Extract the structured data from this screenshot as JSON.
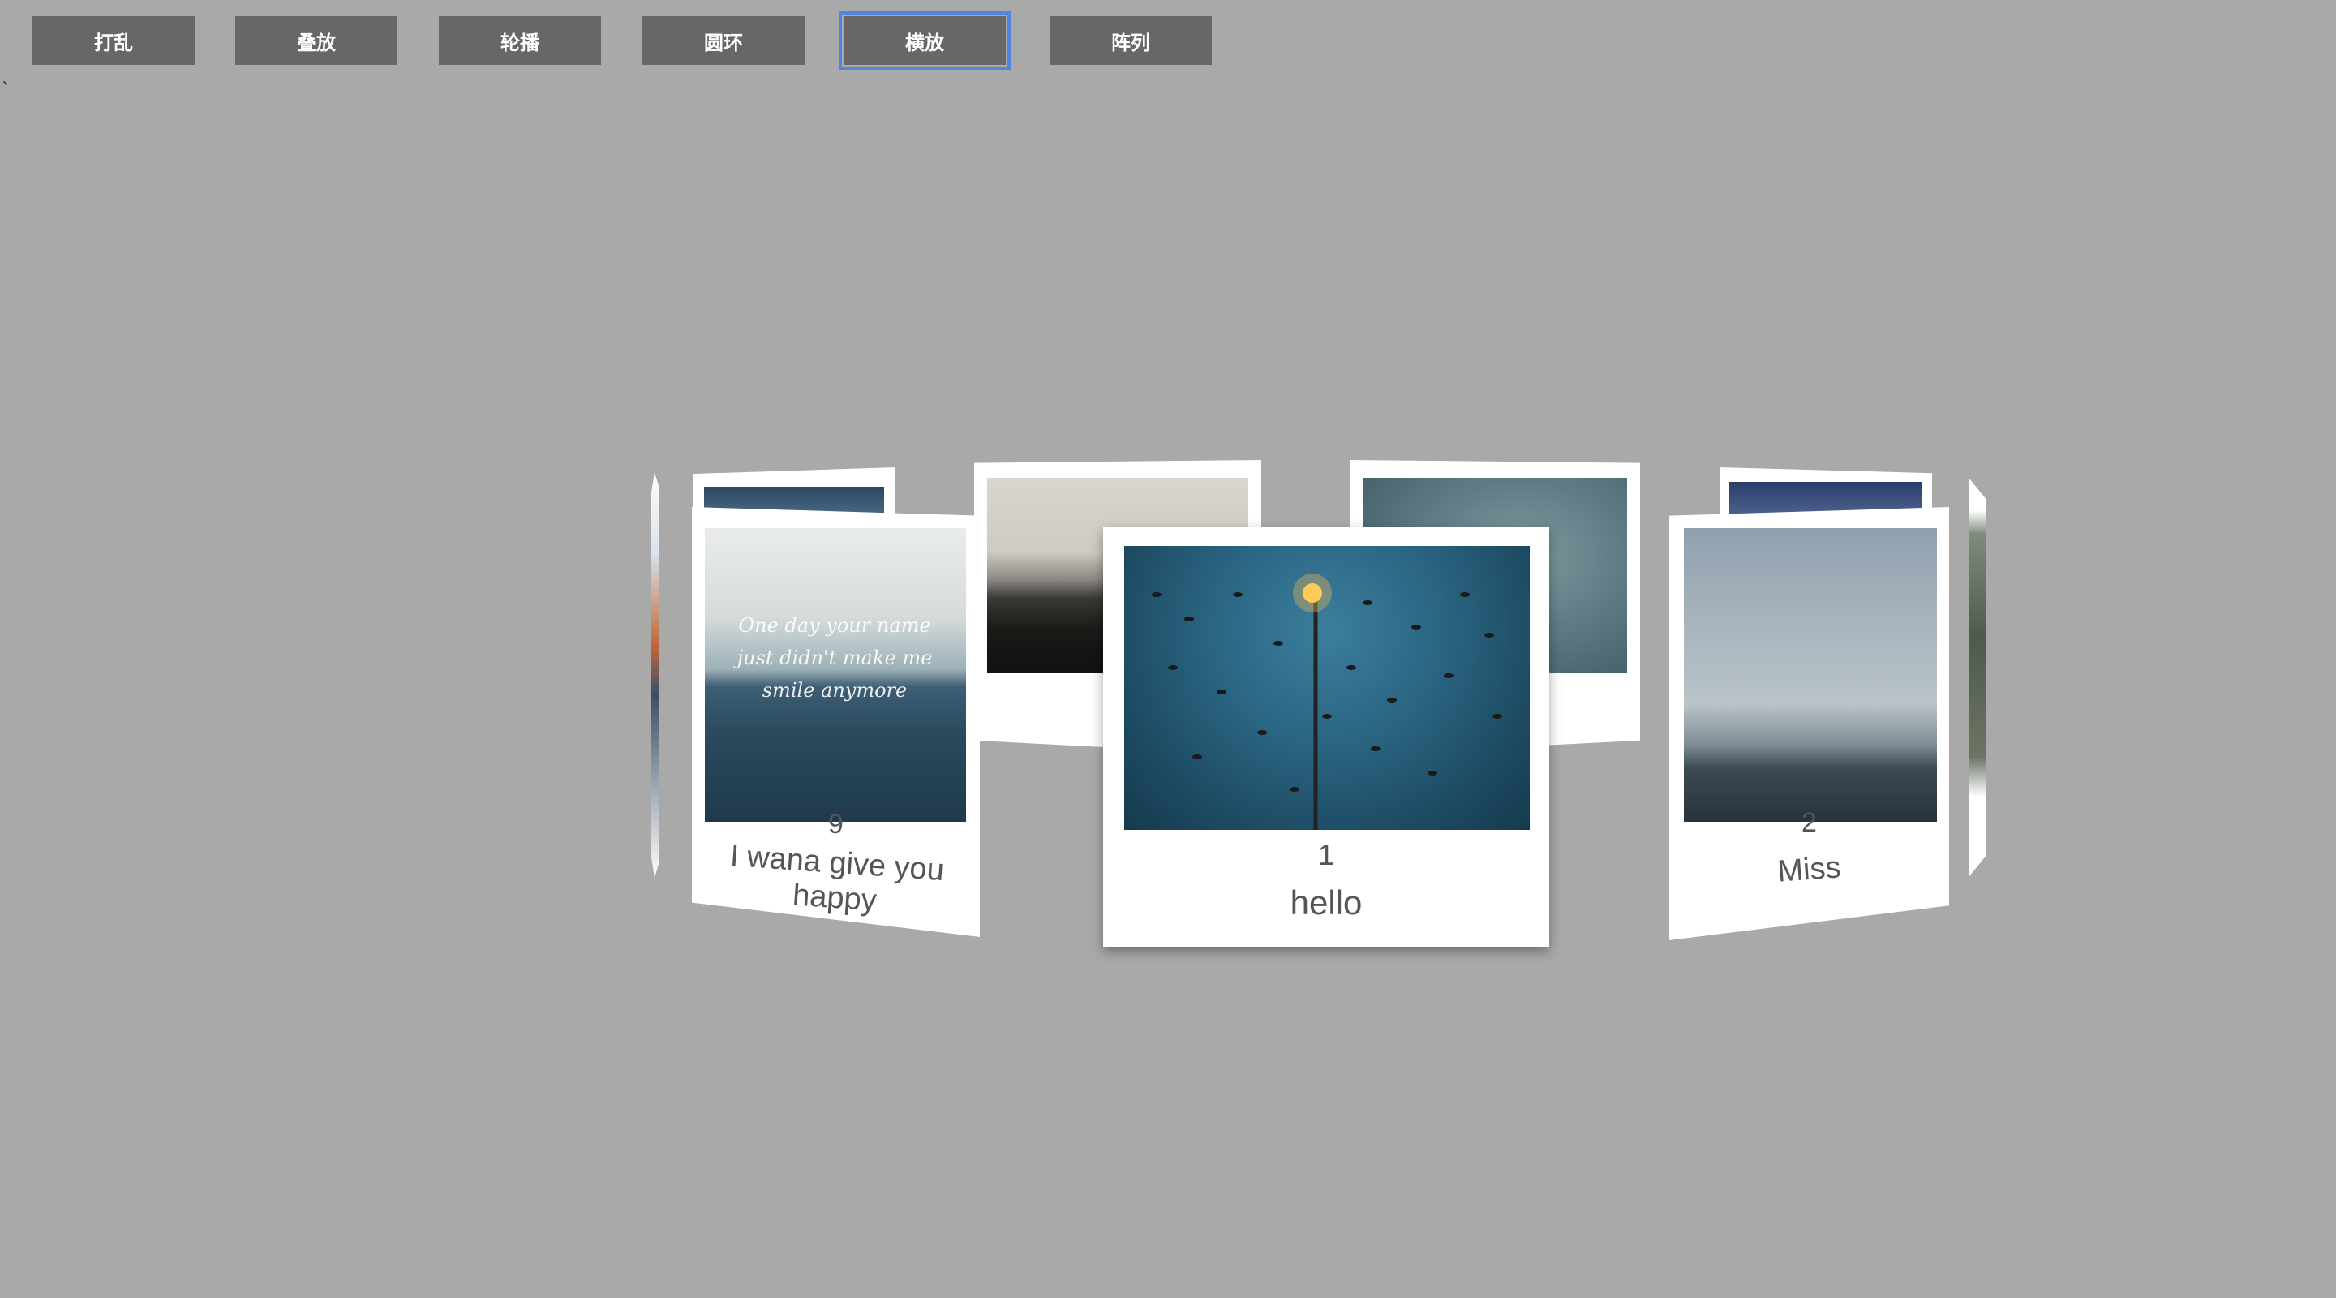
{
  "toolbar": {
    "buttons": [
      {
        "label": "打乱"
      },
      {
        "label": "叠放"
      },
      {
        "label": "轮播"
      },
      {
        "label": "圆环"
      },
      {
        "label": "横放"
      },
      {
        "label": "阵列"
      }
    ],
    "active_index": 4
  },
  "stray_char": "、",
  "cards": {
    "center": {
      "number": "1",
      "caption": "hello"
    },
    "left": {
      "number": "9",
      "caption": "I wana give you happy",
      "photo_text": "One day your name just didn't make me smile anymore"
    },
    "right": {
      "number": "2",
      "caption": "Miss"
    }
  },
  "colors": {
    "background": "#a9a9a9",
    "button_bg": "#676767",
    "button_text": "#ffffff",
    "active_outline": "#4f86e0"
  }
}
